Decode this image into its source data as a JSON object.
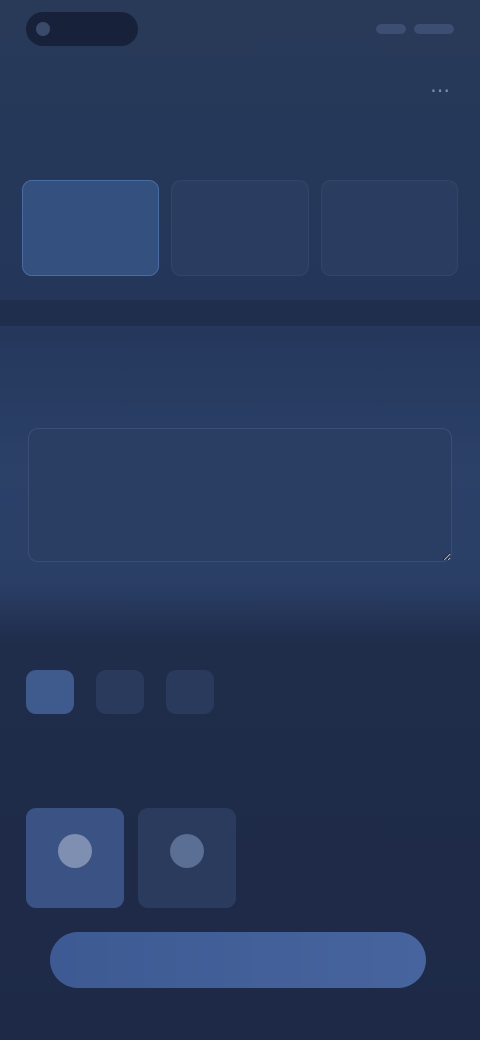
{
  "status_bar": {
    "time": "",
    "colors": {
      "pill": "#17213a"
    }
  },
  "header": {
    "title": "",
    "more_icon": "more-icon"
  },
  "plans": {
    "label": "",
    "items": [
      {
        "name": "",
        "price": "",
        "selected": true
      },
      {
        "name": "",
        "price": "",
        "selected": false
      },
      {
        "name": "",
        "price": "",
        "selected": false
      }
    ]
  },
  "message": {
    "heading": "",
    "placeholder": ""
  },
  "options": {
    "label": "",
    "items": [
      {
        "label": "",
        "active": true
      },
      {
        "label": "",
        "active": false
      },
      {
        "label": "",
        "active": false
      }
    ]
  },
  "wrapping": {
    "label": "",
    "items": [
      {
        "label": "",
        "icon": "gift-icon",
        "selected": true
      },
      {
        "label": "",
        "icon": "box-icon",
        "selected": false
      }
    ]
  },
  "primary_button": {
    "label": ""
  },
  "colors": {
    "background_top": "#283a58",
    "background_bottom": "#1d2947",
    "accent": "#3d5a93",
    "card": "#34507e"
  }
}
